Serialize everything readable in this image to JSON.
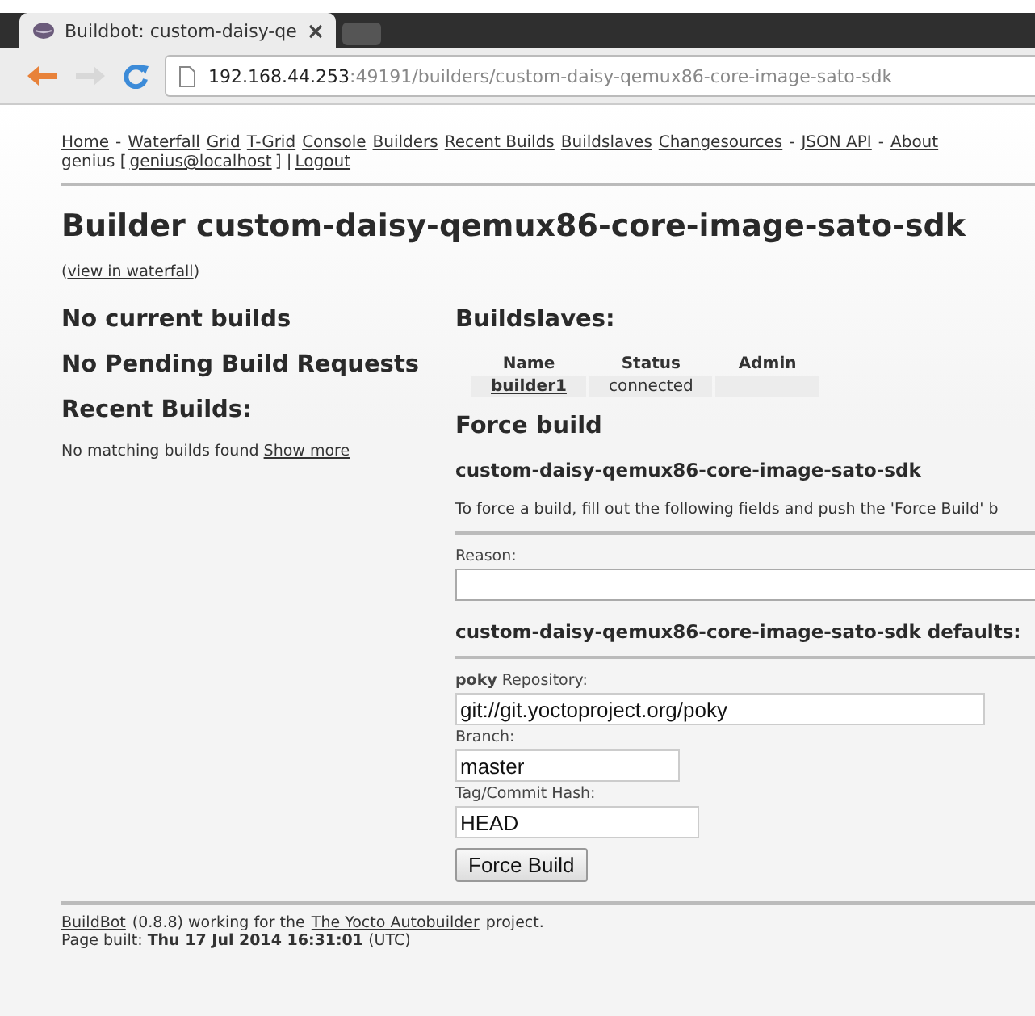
{
  "browser": {
    "tab": {
      "title": "Buildbot: custom-daisy-qe",
      "selected": true
    },
    "address": {
      "host": "192.168.44.253",
      "path": ":49191/builders/custom-daisy-qemux86-core-image-sato-sdk"
    }
  },
  "nav": [
    {
      "kind": "link",
      "text": "Home"
    },
    {
      "kind": "sep",
      "text": "-"
    },
    {
      "kind": "link",
      "text": "Waterfall"
    },
    {
      "kind": "link",
      "text": "Grid"
    },
    {
      "kind": "link",
      "text": "T-Grid"
    },
    {
      "kind": "link",
      "text": "Console"
    },
    {
      "kind": "link",
      "text": "Builders"
    },
    {
      "kind": "link",
      "text": "Recent Builds"
    },
    {
      "kind": "link",
      "text": "Buildslaves"
    },
    {
      "kind": "link",
      "text": "Changesources"
    },
    {
      "kind": "sep",
      "text": "-"
    },
    {
      "kind": "link",
      "text": "JSON API"
    },
    {
      "kind": "sep",
      "text": "-"
    },
    {
      "kind": "link",
      "text": "About"
    }
  ],
  "user_line": [
    {
      "kind": "text",
      "text": "genius ["
    },
    {
      "kind": "link",
      "text": "genius@localhost"
    },
    {
      "kind": "text",
      "text": "] |"
    },
    {
      "kind": "link",
      "text": "Logout"
    }
  ],
  "title": "Builder custom-daisy-qemux86-core-image-sato-sdk",
  "waterfall_line": [
    {
      "kind": "text",
      "text": "("
    },
    {
      "kind": "link",
      "text": "view in waterfall"
    },
    {
      "kind": "text",
      "text": ")"
    }
  ],
  "left": {
    "current": "No current builds",
    "pending": "No Pending Build Requests",
    "recent": "Recent Builds:",
    "no_match": "No matching builds found",
    "show_more": "Show more"
  },
  "buildslaves": {
    "heading": "Buildslaves:",
    "columns": [
      "Name",
      "Status",
      "Admin"
    ],
    "rows": [
      {
        "name": "builder1",
        "status": "connected"
      }
    ]
  },
  "force": {
    "heading": "Force build",
    "builder": "custom-daisy-qemux86-core-image-sato-sdk",
    "instructions": "To force a build, fill out the following fields and push the 'Force Build' b",
    "reason_label": "Reason:",
    "defaults_heading": "custom-daisy-qemux86-core-image-sato-sdk defaults:",
    "repo_project": "poky",
    "repo_label": "Repository:",
    "repo_value": "git://git.yoctoproject.org/poky",
    "branch_label": "Branch:",
    "branch_value": "master",
    "tag_label": "Tag/Commit Hash:",
    "tag_value": "HEAD",
    "button": "Force Build"
  },
  "footer": {
    "line1": [
      {
        "kind": "link",
        "text": "BuildBot"
      },
      {
        "kind": "text",
        "text": "(0.8.8) working for the"
      },
      {
        "kind": "link",
        "text": "The Yocto Autobuilder"
      },
      {
        "kind": "text",
        "text": "project."
      }
    ],
    "built_label": "Page built:",
    "built_time": "Thu 17 Jul 2014 16:31:01",
    "built_zone": "(UTC)"
  }
}
